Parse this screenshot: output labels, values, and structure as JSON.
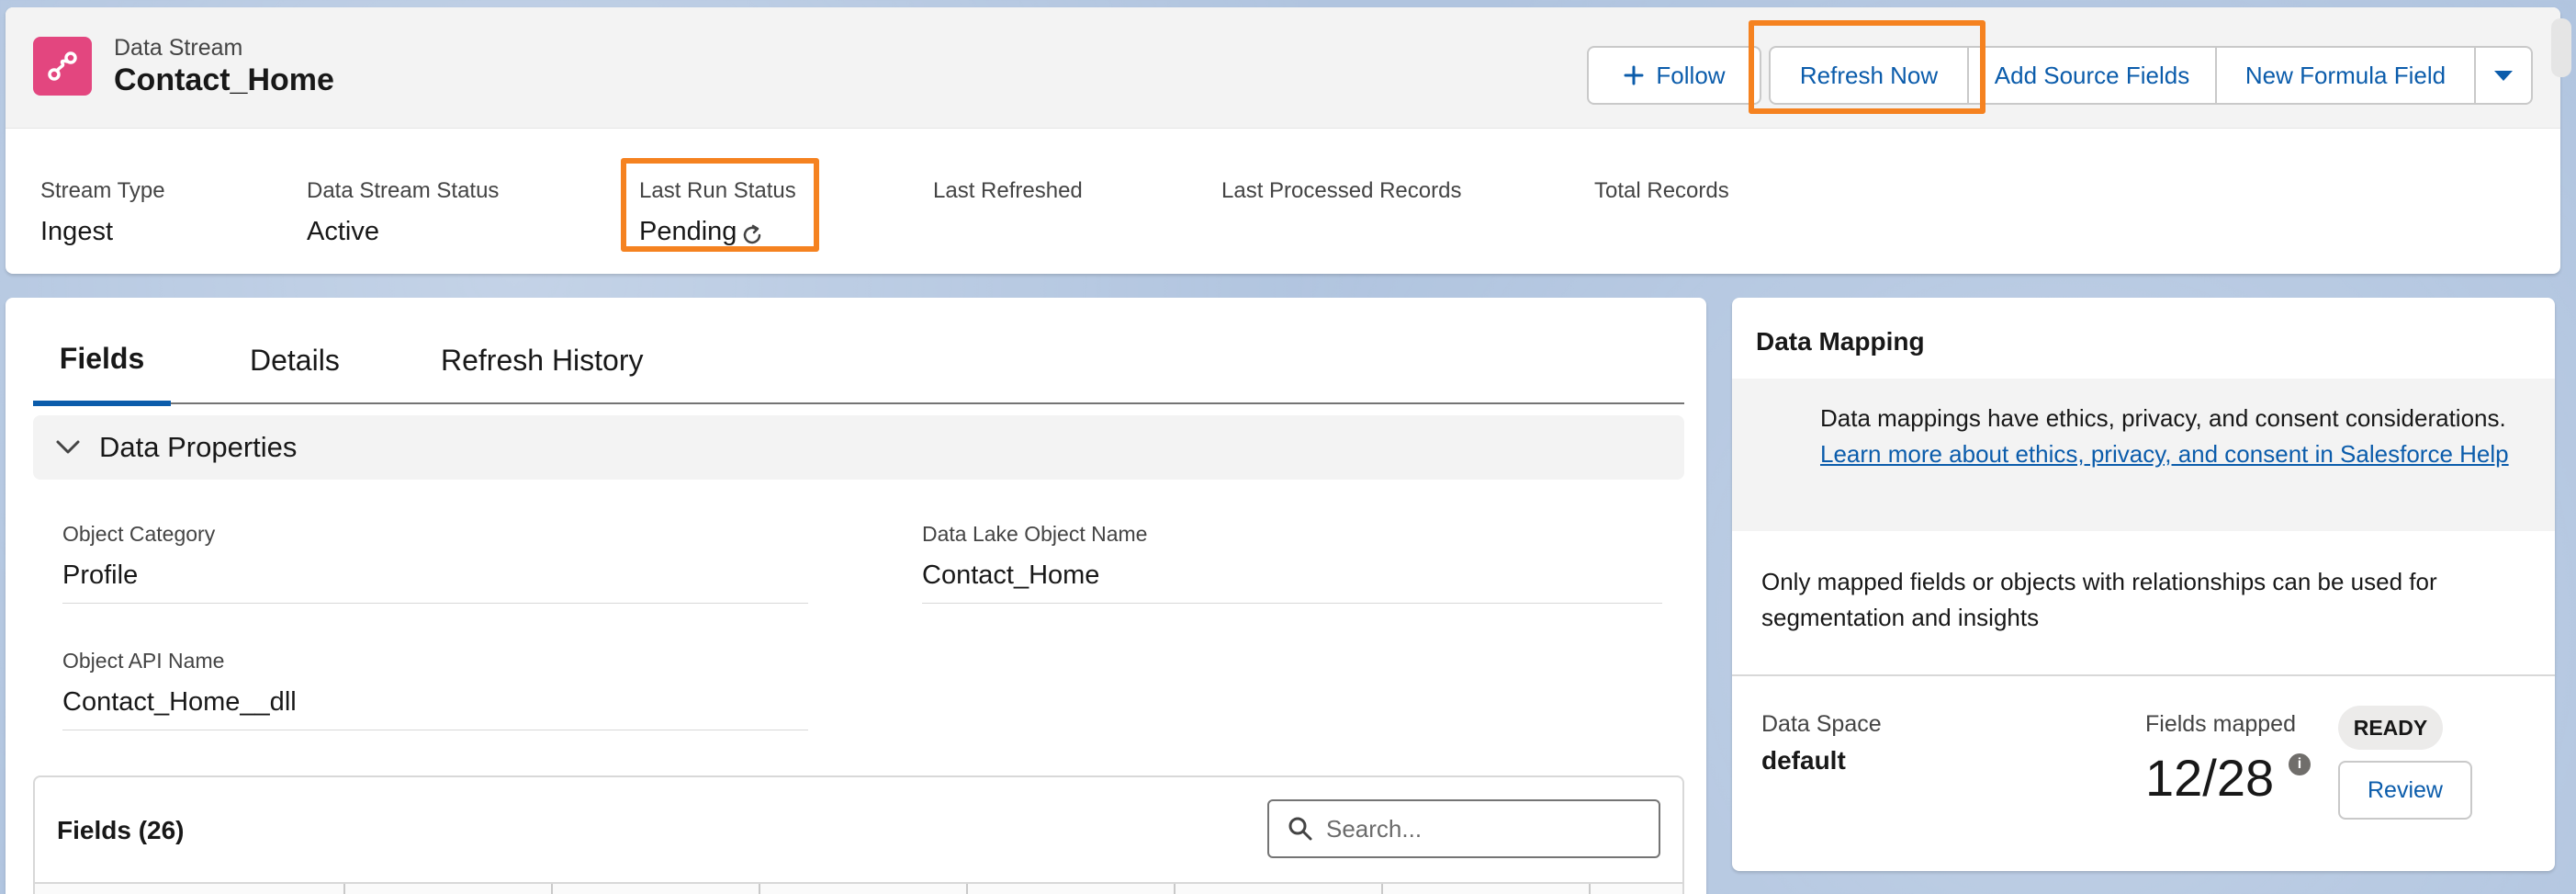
{
  "header": {
    "object_label": "Data Stream",
    "record_name": "Contact_Home",
    "actions": {
      "follow": "Follow",
      "refresh_now": "Refresh Now",
      "add_source_fields": "Add Source Fields",
      "new_formula_field": "New Formula Field"
    },
    "highlights": [
      {
        "label": "Stream Type",
        "value": "Ingest"
      },
      {
        "label": "Data Stream Status",
        "value": "Active"
      },
      {
        "label": "Last Run Status",
        "value": "Pending"
      },
      {
        "label": "Last Refreshed",
        "value": ""
      },
      {
        "label": "Last Processed Records",
        "value": ""
      },
      {
        "label": "Total Records",
        "value": ""
      }
    ]
  },
  "tabs": [
    "Fields",
    "Details",
    "Refresh History"
  ],
  "data_properties": {
    "title": "Data Properties",
    "fields": [
      {
        "label": "Object Category",
        "value": "Profile"
      },
      {
        "label": "Data Lake Object Name",
        "value": "Contact_Home"
      },
      {
        "label": "Object API Name",
        "value": "Contact_Home__dll"
      }
    ]
  },
  "fields_table": {
    "title": "Fields (26)",
    "search_placeholder": "Search..."
  },
  "data_mapping": {
    "title": "Data Mapping",
    "notice_text": "Data mappings have ethics, privacy, and consent considerations.",
    "notice_link": "Learn more about ethics, privacy, and consent in Salesforce Help",
    "info": "Only mapped fields or objects with relationships can be used for segmentation and insights",
    "data_space_label": "Data Space",
    "data_space_value": "default",
    "fields_mapped_label": "Fields mapped",
    "fields_mapped_value": "12/28",
    "status_badge": "READY",
    "review_label": "Review"
  },
  "colors": {
    "brand_blue": "#0b5cab",
    "record_icon": "#e3467f",
    "highlight_orange": "#f58220"
  },
  "icons": {
    "record": "data-stream-icon",
    "follow": "plus-icon",
    "more": "chevron-down-icon",
    "status": "refresh-icon",
    "section": "chevron-down-icon",
    "search": "search-icon",
    "info": "info-icon"
  }
}
